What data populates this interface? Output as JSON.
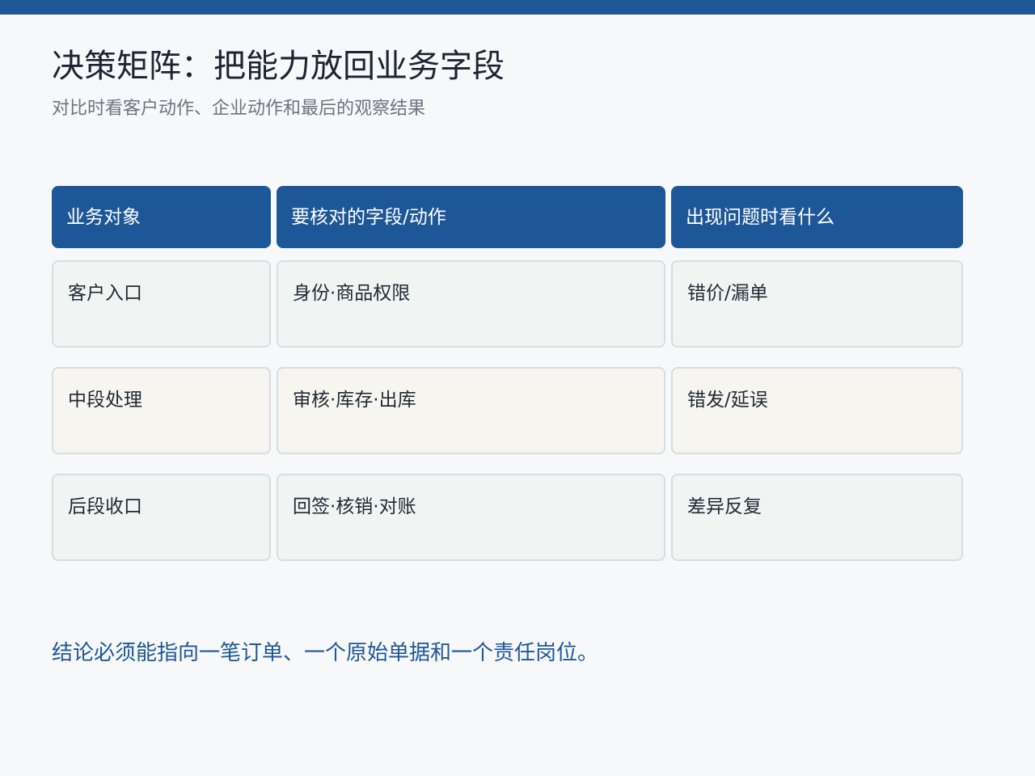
{
  "header": {
    "title": "决策矩阵：把能力放回业务字段",
    "subtitle": "对比时看客户动作、企业动作和最后的观察结果"
  },
  "matrix": {
    "columns": [
      "业务对象",
      "要核对的字段/动作",
      "出现问题时看什么"
    ],
    "rows": [
      [
        "客户入口",
        "身份·商品权限",
        "错价/漏单"
      ],
      [
        "中段处理",
        "审核·库存·出库",
        "错发/延误"
      ],
      [
        "后段收口",
        "回签·核销·对账",
        "差异反复"
      ]
    ]
  },
  "conclusion": "结论必须能指向一笔订单、一个原始单据和一个责任岗位。",
  "colors": {
    "accent": "#1e5797",
    "row_tint_a": "#f0f5f4",
    "row_tint_b": "#f7f5ef",
    "background": "#f6f8fa"
  }
}
